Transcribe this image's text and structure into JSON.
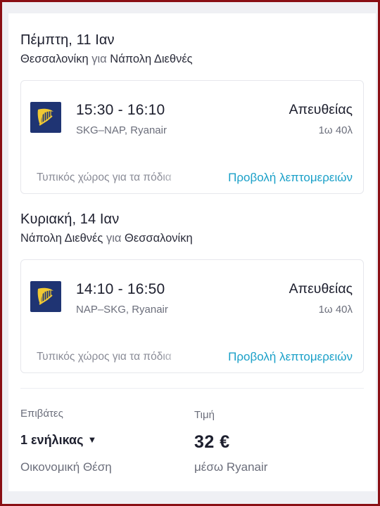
{
  "outbound": {
    "date": "Πέμπτη, 11 Ιαν",
    "from": "Θεσσαλονίκη",
    "connector": "για",
    "to": "Νάπολη Διεθνές",
    "times": "15:30 - 16:10",
    "codes": "SKG–NAP, Ryanair",
    "stops": "Απευθείας",
    "duration": "1ω 40λ",
    "baggage": "Τυπικός χώρος για τα πόδια",
    "details_link": "Προβολή λεπτομερειών"
  },
  "return": {
    "date": "Κυριακή, 14 Ιαν",
    "from": "Νάπολη Διεθνές",
    "connector": "για",
    "to": "Θεσσαλονίκη",
    "times": "14:10 - 16:50",
    "codes": "NAP–SKG, Ryanair",
    "stops": "Απευθείας",
    "duration": "1ω 40λ",
    "baggage": "Τυπικός χώρος για τα πόδια",
    "details_link": "Προβολή λεπτομερειών"
  },
  "summary": {
    "passengers_label": "Επιβάτες",
    "passengers_value": "1 ενήλικας",
    "cabin": "Οικονομική Θέση",
    "price_label": "Τιμή",
    "price": "32 €",
    "via": "μέσω Ryanair"
  },
  "icons": {
    "airline_logo": "ryanair-harp-icon",
    "dropdown": "caret-down-icon"
  },
  "colors": {
    "link": "#1aa0c8",
    "logo_bg": "#1f3473",
    "logo_fg": "#f1c933",
    "frame": "#8a0f14"
  }
}
